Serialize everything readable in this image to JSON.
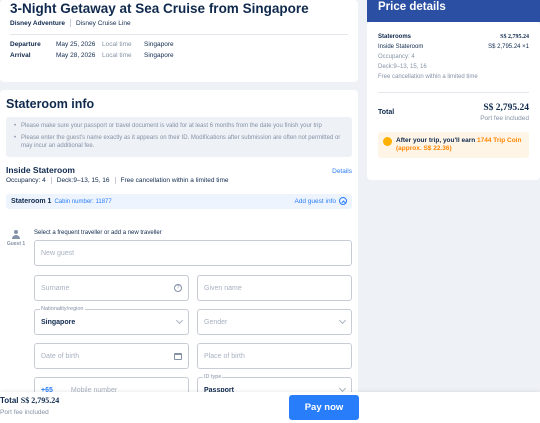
{
  "header": {
    "title": "3-Night Getaway at Sea Cruise from Singapore",
    "ship": "Disney Adventure",
    "line": "Disney Cruise Line",
    "departure": {
      "label": "Departure",
      "date": "May 25, 2026",
      "time_label": "Local time",
      "place": "Singapore"
    },
    "arrival": {
      "label": "Arrival",
      "date": "May 28, 2026",
      "time_label": "Local time",
      "place": "Singapore"
    }
  },
  "stateroom_info": {
    "title": "Stateroom info",
    "notices": [
      "Please make sure your passport or travel document is valid for at least 6 months from the date you finish your trip",
      "Please enter the guest's name exactly as it appears on their ID. Modifications after submission are often not permitted or may incur an additional fee."
    ],
    "room_type": "Inside Stateroom",
    "details_link": "Details",
    "occupancy": "Occupancy: 4",
    "deck": "Deck:9–13, 15, 16",
    "cancellation": "Free cancellation within a limited time",
    "stateroom_label": "Stateroom 1",
    "cabin_number": "Cabin number: 11877",
    "add_guest": "Add guest info",
    "guest_label": "Guest 1",
    "form_hint": "Select a frequent traveller or add a new traveller",
    "fields": {
      "new_guest": "New guest",
      "surname": "Surname",
      "given_name": "Given name",
      "nationality_label": "Nationality/region",
      "nationality_value": "Singapore",
      "gender": "Gender",
      "dob": "Date of birth",
      "pob": "Place of birth",
      "phone_code": "+65",
      "mobile": "Mobile number",
      "id_type_label": "ID type",
      "id_type_value": "Passport"
    }
  },
  "price": {
    "title": "Price details",
    "staterooms_label": "Staterooms",
    "staterooms_value": "S$ 2,795.24",
    "inside_label": "Inside Stateroom",
    "inside_value": "S$ 2,795.24 ×1",
    "occupancy": "Occupancy: 4",
    "deck": "Deck:9–13, 15, 16",
    "cancellation": "Free cancellation within a limited time",
    "total_label": "Total",
    "total_value": "S$ 2,795.24",
    "port_fee": "Port fee included",
    "earn_text": "After your trip, you'll earn",
    "earn_coins": "1744 Trip Coin",
    "earn_approx": "(approx. S$ 22.36)"
  },
  "bottom": {
    "total_label": "Total",
    "total_value": "S$ 2,795.24",
    "port_fee": "Port fee included",
    "pay_button": "Pay now"
  }
}
